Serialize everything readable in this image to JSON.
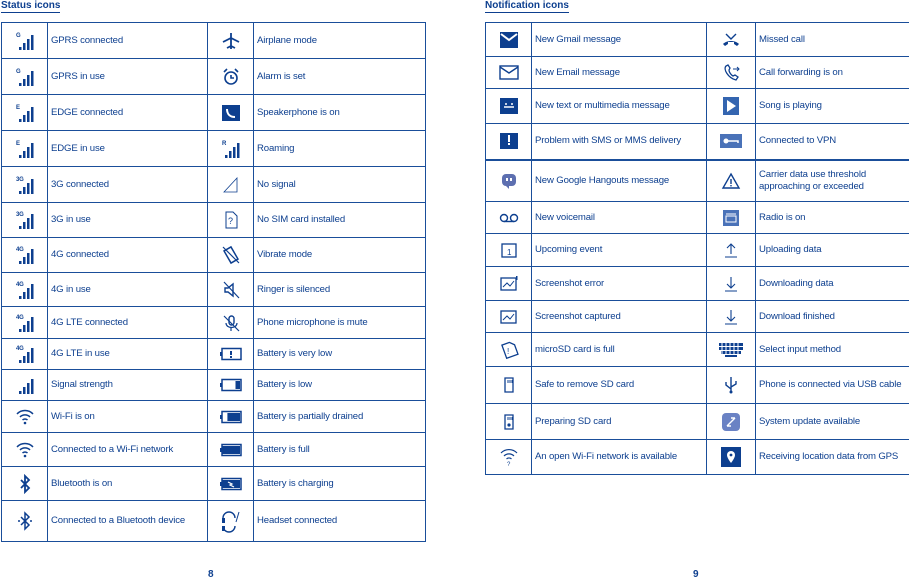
{
  "accent_color": "#0d3f8f",
  "left": {
    "heading": "Status icons",
    "page_number": "8",
    "rows": [
      {
        "icon1": "gprs-connected-icon",
        "label1": "GPRS connected",
        "icon2": "airplane-icon",
        "label2": "Airplane mode"
      },
      {
        "icon1": "gprs-in-use-icon",
        "label1": "GPRS in use",
        "icon2": "alarm-icon",
        "label2": "Alarm is set"
      },
      {
        "icon1": "edge-connected-icon",
        "label1": "EDGE connected",
        "icon2": "speakerphone-icon",
        "label2": "Speakerphone is on"
      },
      {
        "icon1": "edge-in-use-icon",
        "label1": "EDGE in use",
        "icon2": "roaming-icon",
        "label2": "Roaming"
      },
      {
        "icon1": "3g-connected-icon",
        "label1": "3G connected",
        "icon2": "no-signal-icon",
        "label2": "No signal"
      },
      {
        "icon1": "3g-in-use-icon",
        "label1": "3G in use",
        "icon2": "no-sim-icon",
        "label2": "No SIM card installed"
      },
      {
        "icon1": "4g-connected-icon",
        "label1": "4G connected",
        "icon2": "vibrate-icon",
        "label2": "Vibrate mode"
      },
      {
        "icon1": "4g-in-use-icon",
        "label1": "4G in use",
        "icon2": "ringer-silenced-icon",
        "label2": "Ringer is silenced"
      },
      {
        "icon1": "4g-lte-connected-icon",
        "label1": "4G LTE connected",
        "icon2": "mic-mute-icon",
        "label2": "Phone microphone is mute"
      },
      {
        "icon1": "4g-lte-in-use-icon",
        "label1": "4G LTE in use",
        "icon2": "battery-very-low-icon",
        "label2": "Battery is very low"
      },
      {
        "icon1": "signal-strength-icon",
        "label1": "Signal strength",
        "icon2": "battery-low-icon",
        "label2": "Battery is low"
      },
      {
        "icon1": "wifi-icon",
        "label1": "Wi-Fi is on",
        "icon2": "battery-partial-icon",
        "label2": "Battery is partially drained"
      },
      {
        "icon1": "wifi-connected-icon",
        "label1": "Connected to a Wi-Fi network",
        "icon2": "battery-full-icon",
        "label2": "Battery is full"
      },
      {
        "icon1": "bluetooth-icon",
        "label1": "Bluetooth is on",
        "icon2": "battery-charging-icon",
        "label2": "Battery is charging"
      },
      {
        "icon1": "bluetooth-connected-icon",
        "label1": "Connected to a Bluetooth device",
        "icon2": "headset-icon",
        "label2": "Headset connected"
      }
    ]
  },
  "right": {
    "heading": "Notification icons",
    "page_number": "9",
    "rows": [
      {
        "icon1": "gmail-icon",
        "label1": "New Gmail message",
        "icon2": "missed-call-icon",
        "label2": "Missed call"
      },
      {
        "icon1": "email-icon",
        "label1": "New Email message",
        "icon2": "call-forward-icon",
        "label2": "Call forwarding is on"
      },
      {
        "icon1": "sms-icon",
        "label1": "New text or multimedia message",
        "icon2": "play-icon",
        "label2": "Song is playing"
      },
      {
        "icon1": "sms-error-icon",
        "label1": "Problem with SMS or MMS delivery",
        "icon2": "vpn-key-icon",
        "label2": "Connected to VPN"
      },
      {
        "icon1": "hangouts-icon",
        "label1": "New Google Hangouts message",
        "icon2": "warning-icon",
        "label2": "Carrier data use threshold approaching or exceeded"
      },
      {
        "icon1": "voicemail-icon",
        "label1": "New voicemail",
        "icon2": "radio-icon",
        "label2": "Radio is on"
      },
      {
        "icon1": "calendar-icon",
        "label1": "Upcoming event",
        "icon2": "upload-icon",
        "label2": "Uploading data"
      },
      {
        "icon1": "screenshot-error-icon",
        "label1": "Screenshot error",
        "icon2": "download-icon",
        "label2": "Downloading data"
      },
      {
        "icon1": "screenshot-icon",
        "label1": " Screenshot captured",
        "icon2": "download-done-icon",
        "label2": "Download finished"
      },
      {
        "icon1": "sd-full-icon",
        "label1": "microSD card is full",
        "icon2": "keyboard-icon",
        "label2": "Select input method"
      },
      {
        "icon1": "sd-remove-icon",
        "label1": "Safe to remove SD card",
        "icon2": "usb-icon",
        "label2": "Phone is connected via USB cable"
      },
      {
        "icon1": "sd-preparing-icon",
        "label1": "Preparing SD card",
        "icon2": "system-update-icon",
        "label2": "System update available"
      },
      {
        "icon1": "open-wifi-icon",
        "label1": "An open Wi-Fi network is available",
        "icon2": "gps-icon",
        "label2": "Receiving location data from GPS"
      }
    ]
  }
}
